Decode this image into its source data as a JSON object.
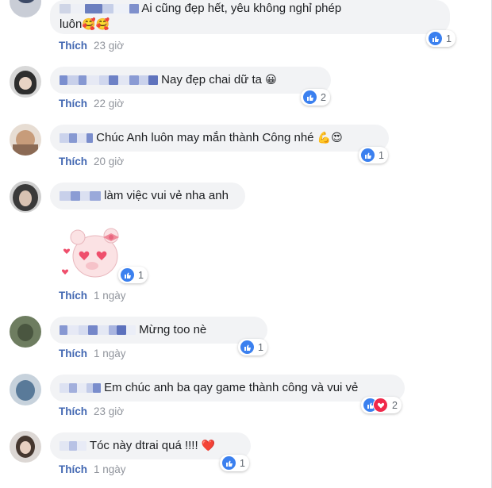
{
  "comments": [
    {
      "text": "Ai cũng đẹp hết, yêu không nghỉ phép",
      "text2": "luôn",
      "emoji": "🥰🥰",
      "like": "Thích",
      "time": "23 giờ",
      "count": "1"
    },
    {
      "text": "Nay đẹp chai dữ ta",
      "emoji": "😀",
      "like": "Thích",
      "time": "22 giờ",
      "count": "2"
    },
    {
      "text": "Chúc Anh luôn may mắn thành Công nhé",
      "emoji": "💪😍",
      "like": "Thích",
      "time": "20 giờ",
      "count": "1"
    },
    {
      "text": "làm việc vui vẻ nha anh",
      "like": "Thích",
      "time": "1 ngày",
      "count": "1"
    },
    {
      "text": "Mừng too nè",
      "like": "Thích",
      "time": "1 ngày",
      "count": "1"
    },
    {
      "text": "Em chúc anh ba qay game thành công và vui vẻ",
      "like": "Thích",
      "time": "23 giờ",
      "count": "2"
    },
    {
      "text": "Tóc này dtrai quá !!!!",
      "emoji": "❤️",
      "like": "Thích",
      "time": "1 ngày",
      "count": "1"
    }
  ],
  "colors": {
    "bubble": "#f2f3f5",
    "link": "#4267b2",
    "meta": "#90949c",
    "like_icon": "#3b80ef",
    "heart": "#f0284a"
  }
}
